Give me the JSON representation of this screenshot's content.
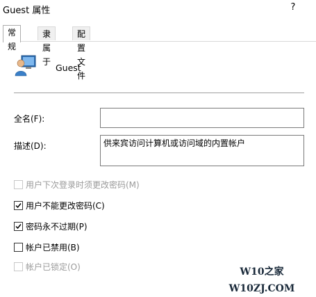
{
  "window": {
    "title": "Guest 属性",
    "help_label": "?"
  },
  "tabs": [
    {
      "label": "常规",
      "active": true
    },
    {
      "label": "隶属于",
      "active": false
    },
    {
      "label": "配置文件",
      "active": false
    }
  ],
  "user": {
    "name": "Guest",
    "icon": "user-account-icon"
  },
  "fields": {
    "full_name": {
      "label": "全名(F):",
      "value": ""
    },
    "description": {
      "label": "描述(D):",
      "value": "供来宾访问计算机或访问域的内置帐户"
    }
  },
  "checkboxes": [
    {
      "label": "用户下次登录时须更改密码(M)",
      "checked": false,
      "enabled": false
    },
    {
      "label": "用户不能更改密码(C)",
      "checked": true,
      "enabled": true
    },
    {
      "label": "密码永不过期(P)",
      "checked": true,
      "enabled": true
    },
    {
      "label": "帐户已禁用(B)",
      "checked": false,
      "enabled": true
    },
    {
      "label": "帐户已锁定(O)",
      "checked": false,
      "enabled": false
    }
  ],
  "watermark": "W10之家 W10ZJ.COM"
}
